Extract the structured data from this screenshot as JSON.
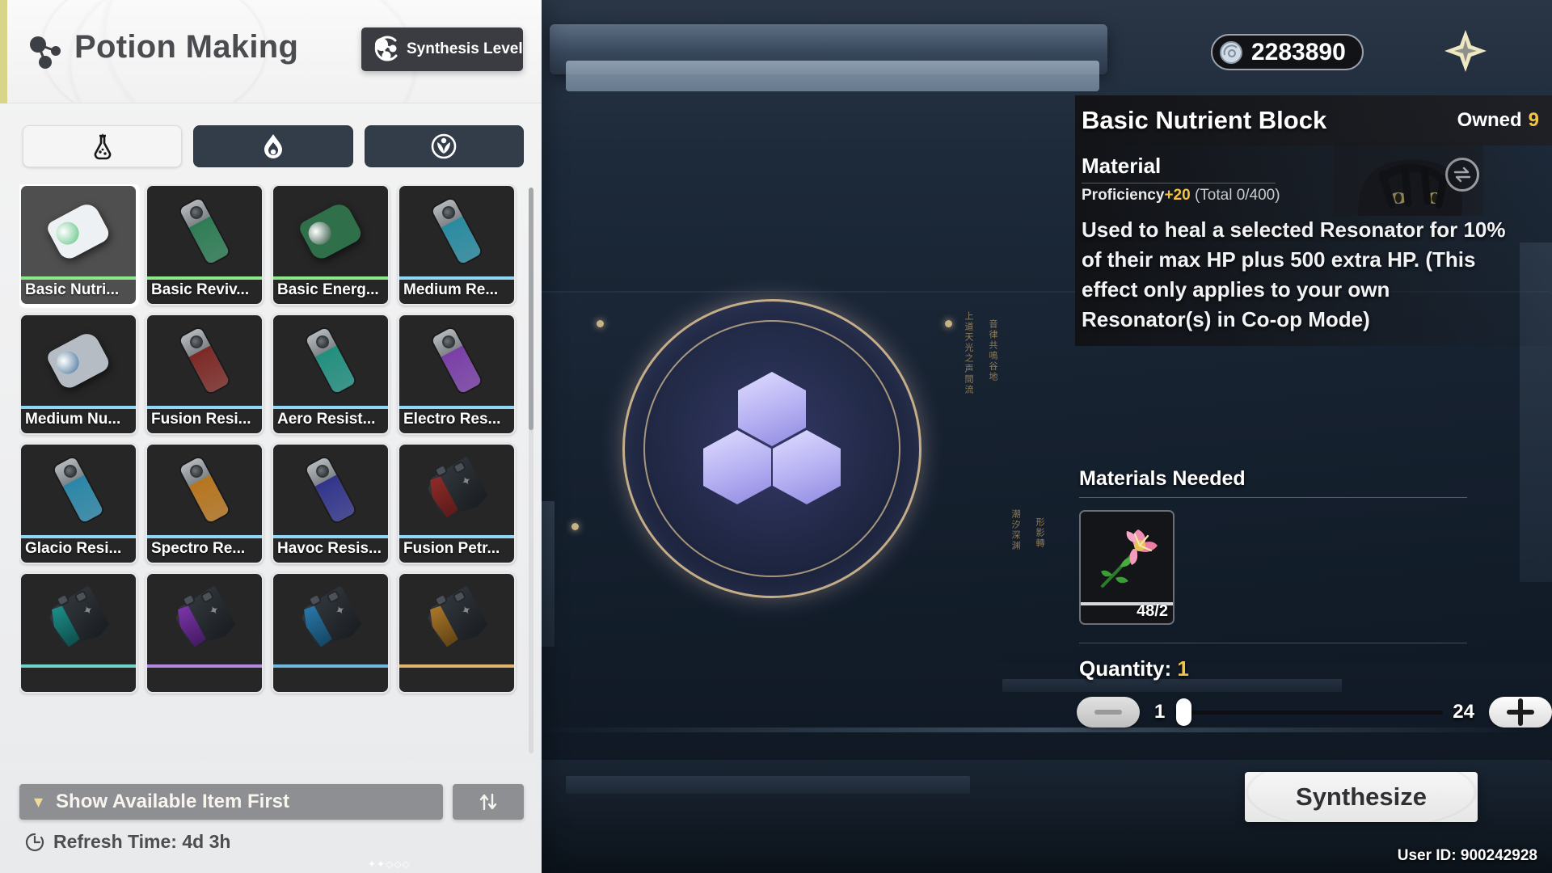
{
  "header": {
    "title": "Potion Making",
    "icon": "molecule-icon",
    "synthesis_badge": {
      "label": "Synthesis Level",
      "stars_filled": 2,
      "stars_total": 5,
      "icon": "molecule-icon"
    }
  },
  "hud": {
    "currency_value": "2283890",
    "currency_icon": "shell-credit-icon",
    "close_icon": "close-star-icon",
    "swap_icon": "swap-icon",
    "user_id": "User ID: 900242928"
  },
  "tabs": [
    {
      "name": "tab-potion",
      "icon": "flask-icon",
      "active": true
    },
    {
      "name": "tab-elixir",
      "icon": "flame-drop-icon",
      "active": false
    },
    {
      "name": "tab-special",
      "icon": "sprout-orb-icon",
      "active": false
    }
  ],
  "grid": {
    "items": [
      {
        "label": "Basic Nutri...",
        "quality": "#8ce88a",
        "art": "pouch",
        "c1": "#eef1f3",
        "c2": "#57c07e",
        "selected": true
      },
      {
        "label": "Basic Reviv...",
        "quality": "#8ce88a",
        "art": "vial",
        "c1": "#9fa5aa",
        "c2": "#2f7d55",
        "selected": false
      },
      {
        "label": "Basic Energ...",
        "quality": "#8ce88a",
        "art": "pouch",
        "c1": "#2f6f4a",
        "c2": "#1d4a31",
        "selected": false
      },
      {
        "label": "Medium Re...",
        "quality": "#8fd7f5",
        "art": "vial",
        "c1": "#a4aab0",
        "c2": "#2a8ba0",
        "selected": false
      },
      {
        "label": "Medium Nu...",
        "quality": "#8fd7f5",
        "art": "pouch",
        "c1": "#b6bcc4",
        "c2": "#3c6a93",
        "selected": false
      },
      {
        "label": "Fusion Resi...",
        "quality": "#8fd7f5",
        "art": "vial",
        "c1": "#a4aab0",
        "c2": "#7e2a26",
        "selected": false
      },
      {
        "label": "Aero Resist...",
        "quality": "#8fd7f5",
        "art": "vial",
        "c1": "#a4aab0",
        "c2": "#23907f",
        "selected": false
      },
      {
        "label": "Electro Res...",
        "quality": "#8fd7f5",
        "art": "vial",
        "c1": "#a4aab0",
        "c2": "#7b3fa8",
        "selected": false
      },
      {
        "label": "Glacio Resi...",
        "quality": "#8fd7f5",
        "art": "vial",
        "c1": "#a4aab0",
        "c2": "#2c87a8",
        "selected": false
      },
      {
        "label": "Spectro Re...",
        "quality": "#8fd7f5",
        "art": "vial",
        "c1": "#a4aab0",
        "c2": "#b7761f",
        "selected": false
      },
      {
        "label": "Havoc Resis...",
        "quality": "#8fd7f5",
        "art": "vial",
        "c1": "#a4aab0",
        "c2": "#33358c",
        "selected": false
      },
      {
        "label": "Fusion Petr...",
        "quality": "#8fd7f5",
        "art": "tank",
        "c1": "#8d2b28",
        "c2": "#5d1b1a",
        "selected": false
      },
      {
        "label": "",
        "quality": "#6fd2cb",
        "art": "tank",
        "c1": "#1d8c87",
        "c2": "#0f4f4c",
        "selected": false
      },
      {
        "label": "",
        "quality": "#b48ae0",
        "art": "tank",
        "c1": "#7a35a8",
        "c2": "#451a63",
        "selected": false
      },
      {
        "label": "",
        "quality": "#6fb6e0",
        "art": "tank",
        "c1": "#2a76a8",
        "c2": "#154763",
        "selected": false
      },
      {
        "label": "",
        "quality": "#e0b46f",
        "art": "tank",
        "c1": "#a8762a",
        "c2": "#634415",
        "selected": false
      }
    ]
  },
  "footer": {
    "available_first_label": "Show Available Item First",
    "available_first_chevron": "chevron-down-icon",
    "sort_icon": "sort-updown-icon",
    "refresh_icon": "clock-icon",
    "refresh_text": "Refresh Time: 4d 3h"
  },
  "detail": {
    "title": "Basic Nutrient Block",
    "owned_label": "Owned",
    "owned_count": "9",
    "type": "Material",
    "proficiency_prefix": "Proficiency",
    "proficiency_gain": "+20",
    "proficiency_total": "(Total 0/400)",
    "description": "Used to heal a selected Resonator for 10% of their max HP plus 500 extra HP. (This effect only applies to your own Resonator(s) in Co-op Mode)",
    "materials_title": "Materials Needed",
    "materials": [
      {
        "name": "pink-flower-material",
        "count": "48/2",
        "quality": "#d7d9dc"
      }
    ],
    "quantity_label": "Quantity:",
    "quantity_value": "1",
    "slider_min": "1",
    "slider_max": "24",
    "minus_label": "–",
    "plus_label": "+",
    "synthesize_label": "Synthesize"
  }
}
